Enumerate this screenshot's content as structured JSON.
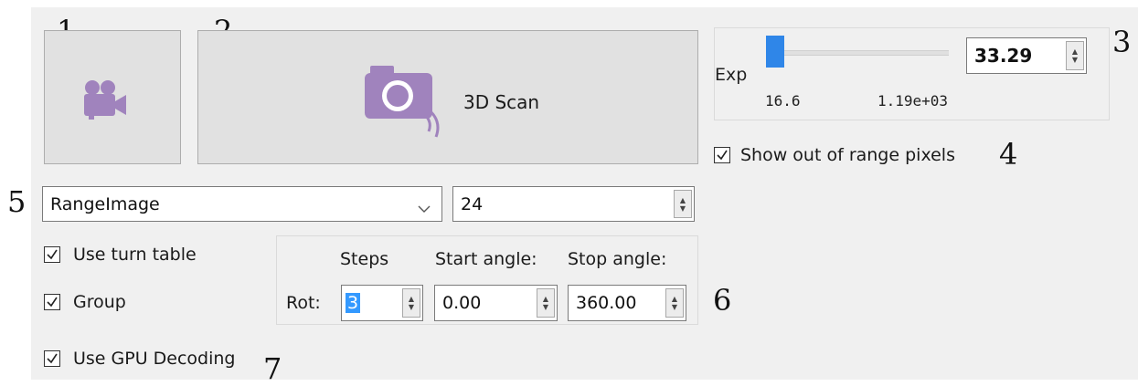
{
  "callouts": [
    "1",
    "2",
    "3",
    "4",
    "5",
    "6",
    "7"
  ],
  "camera_button": {
    "icon": "video-camera-icon"
  },
  "scan_button": {
    "icon": "camera-icon",
    "label": "3D Scan"
  },
  "exposure": {
    "label": "Exp",
    "slider_position": 0.02,
    "min_label": "16.6",
    "max_label": "1.19e+03",
    "value": "33.29"
  },
  "show_out_of_range": {
    "label": "Show out of range pixels",
    "checked": true
  },
  "image_type_select": {
    "value": "RangeImage"
  },
  "bit_depth_spinbox": {
    "value": "24"
  },
  "use_turn_table": {
    "label": "Use turn table",
    "checked": true
  },
  "group": {
    "label": "Group",
    "checked": true
  },
  "use_gpu_decoding": {
    "label": "Use GPU Decoding",
    "checked": true
  },
  "rotation": {
    "row_label": "Rot:",
    "headers": {
      "steps": "Steps",
      "start": "Start angle:",
      "stop": "Stop angle:"
    },
    "steps": "3",
    "start_angle": "0.00",
    "stop_angle": "360.00"
  },
  "colors": {
    "icon_purple": "#a083bd",
    "slider_blue": "#2f86e8",
    "selection_blue": "#3399ff"
  }
}
